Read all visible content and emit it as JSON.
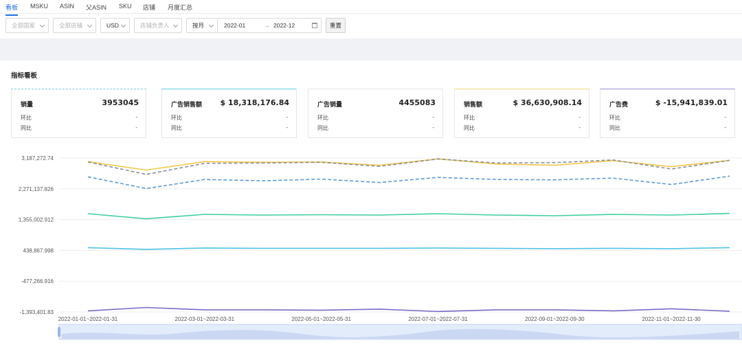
{
  "tabs": [
    {
      "label": "看板",
      "active": true
    },
    {
      "label": "MSKU",
      "active": false
    },
    {
      "label": "ASIN",
      "active": false
    },
    {
      "label": "父ASIN",
      "active": false
    },
    {
      "label": "SKU",
      "active": false
    },
    {
      "label": "店铺",
      "active": false
    },
    {
      "label": "月度汇总",
      "active": false
    }
  ],
  "filters": {
    "country": "全部国家",
    "shop": "全部店铺",
    "currency": "USD",
    "owner": "店铺负责人",
    "period": "按月",
    "date_start": "2022-01",
    "date_end": "2022-12",
    "range_arrow": "→",
    "reset_label": "重置"
  },
  "section_title": "指标看板",
  "cards": [
    {
      "label": "销量",
      "value": "3953045",
      "mom_label": "环比",
      "mom": "-",
      "wow_label": "同比",
      "wow": "-",
      "accent": "#7ec8e3",
      "dashed": true
    },
    {
      "label": "广告销售额",
      "value": "$ 18,318,176.84",
      "mom_label": "环比",
      "mom": "-",
      "wow_label": "同比",
      "wow": "-",
      "accent": "#5fd0df",
      "dashed": false
    },
    {
      "label": "广告销量",
      "value": "4455083",
      "mom_label": "环比",
      "mom": "-",
      "wow_label": "同比",
      "wow": "-",
      "accent": "#e6e6e6",
      "dashed": false
    },
    {
      "label": "销售额",
      "value": "$ 36,630,908.14",
      "mom_label": "环比",
      "mom": "-",
      "wow_label": "同比",
      "wow": "-",
      "accent": "#f0d77a",
      "dashed": false
    },
    {
      "label": "广告费",
      "value": "$ -15,941,839.01",
      "mom_label": "环比",
      "mom": "-",
      "wow_label": "同比",
      "wow": "-",
      "accent": "#9a8fd6",
      "dashed": false
    }
  ],
  "chart_data": {
    "type": "line",
    "categories": [
      "2022-01-01~2022-01-31",
      "2022-02-01~2022-02-28",
      "2022-03-01~2022-03-31",
      "2022-04-01~2022-04-30",
      "2022-05-01~2022-05-31",
      "2022-06-01~2022-06-30",
      "2022-07-01~2022-07-31",
      "2022-08-01~2022-08-31",
      "2022-09-01~2022-09-30",
      "2022-10-01~2022-10-31",
      "2022-11-01~2022-11-30",
      "2022-12-01~2022-12-31"
    ],
    "x_tick_labels_shown": [
      "2022-01-01~2022-01-31",
      "2022-03-01~2022-03-31",
      "2022-05-01~2022-05-31",
      "2022-07-01~2022-07-31",
      "2022-09-01~2022-09-30",
      "2022-11-01~2022-11-30"
    ],
    "y_ticks": [
      "3,187,272.74",
      "2,271,137.826",
      "1,355,002.912",
      "438,867.998",
      "-477,266.916",
      "-1,393,401.83"
    ],
    "ylim": [
      -1393401.83,
      3187272.74
    ],
    "grid": true,
    "series": [
      {
        "name": "销售额",
        "color": "#f0c84a",
        "dash": false,
        "values": [
          3080000,
          2830000,
          3080000,
          3060000,
          3070000,
          2970000,
          3160000,
          3010000,
          2970000,
          3110000,
          2930000,
          3120000
        ]
      },
      {
        "name": "广告销量",
        "color": "#8a8f99",
        "dash": true,
        "values": [
          3070000,
          2700000,
          3030000,
          3040000,
          3060000,
          2940000,
          3160000,
          3040000,
          3050000,
          3130000,
          2860000,
          3120000
        ]
      },
      {
        "name": "销量",
        "color": "#5b9bd5",
        "dash": true,
        "values": [
          2630000,
          2280000,
          2550000,
          2510000,
          2560000,
          2460000,
          2610000,
          2550000,
          2540000,
          2590000,
          2400000,
          2650000
        ]
      },
      {
        "name": "广告销售额",
        "color": "#3fcf9c",
        "dash": false,
        "values": [
          1530000,
          1380000,
          1510000,
          1490000,
          1500000,
          1490000,
          1530000,
          1490000,
          1470000,
          1510000,
          1490000,
          1540000
        ]
      },
      {
        "name": "",
        "color": "#4fc3e6",
        "dash": false,
        "values": [
          520000,
          470000,
          510000,
          500000,
          500000,
          500000,
          510000,
          500000,
          490000,
          500000,
          490000,
          520000
        ]
      },
      {
        "name": "广告费",
        "color": "#7b6bc8",
        "dash": false,
        "values": [
          -1360000,
          -1260000,
          -1330000,
          -1330000,
          -1340000,
          -1310000,
          -1380000,
          -1330000,
          -1330000,
          -1360000,
          -1300000,
          -1370000
        ]
      }
    ]
  }
}
